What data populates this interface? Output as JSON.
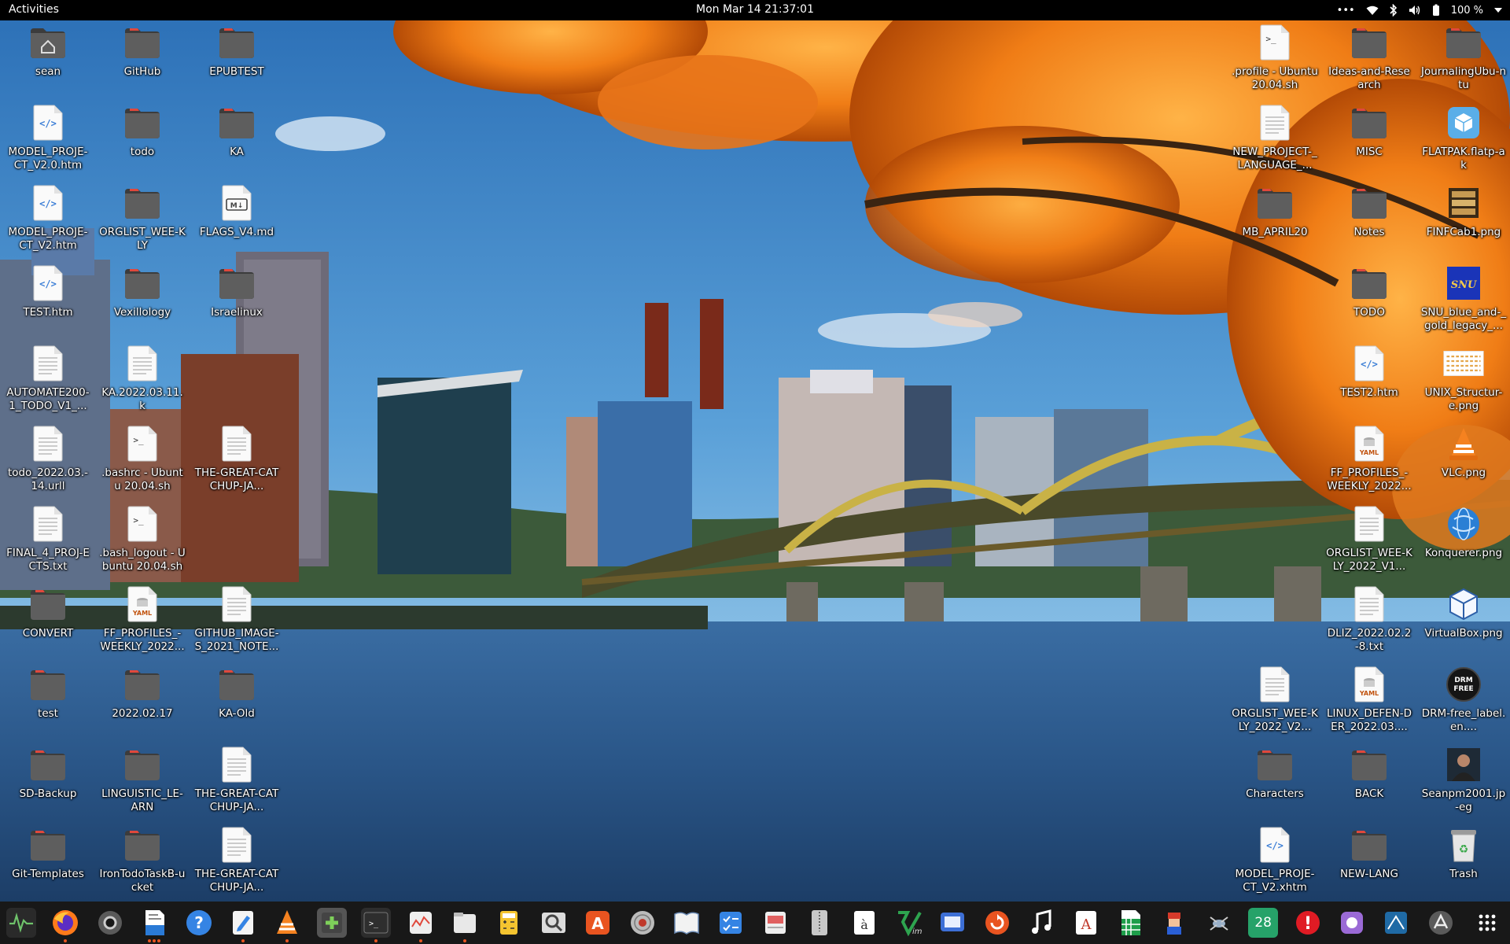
{
  "topbar": {
    "activities": "Activities",
    "clock": "Mon Mar 14  21:37:01",
    "battery": "100 %"
  },
  "desktop": {
    "icons": [
      {
        "label": "sean",
        "type": "home"
      },
      {
        "label": "GitHub",
        "type": "folder"
      },
      {
        "label": "EPUBTEST",
        "type": "folder"
      },
      {
        "label": "MODEL_PROJE-CT_V2.0.htm",
        "type": "html"
      },
      {
        "label": "todo",
        "type": "folder"
      },
      {
        "label": "KA",
        "type": "folder"
      },
      {
        "label": "MODEL_PROJE-CT_V2.htm",
        "type": "html"
      },
      {
        "label": "ORGLIST_WEE-KLY",
        "type": "folder"
      },
      {
        "label": "FLAGS_V4.md",
        "type": "md"
      },
      {
        "label": "TEST.htm",
        "type": "html"
      },
      {
        "label": "Vexillology",
        "type": "folder"
      },
      {
        "label": "Israelinux",
        "type": "folder"
      },
      {
        "label": "AUTOMATE200-1_TODO_V1_...",
        "type": "text"
      },
      {
        "label": "KA.2022.03.11.k",
        "type": "text"
      },
      {
        "label": "todo_2022.03.-14.urll",
        "type": "text"
      },
      {
        "label": ".bashrc - Ubuntu 20.04.sh",
        "type": "script"
      },
      {
        "label": "THE-GREAT-CATCHUP-JA...",
        "type": "text"
      },
      {
        "label": "FINAL_4_PROJ-ECTS.txt",
        "type": "text"
      },
      {
        "label": ".bash_logout - Ubuntu 20.04.sh",
        "type": "script"
      },
      {
        "label": "CONVERT",
        "type": "folder"
      },
      {
        "label": "FF_PROFILES_-WEEKLY_2022...",
        "type": "yaml"
      },
      {
        "label": "GITHUB_IMAGE-S_2021_NOTE...",
        "type": "text"
      },
      {
        "label": "test",
        "type": "folder"
      },
      {
        "label": "2022.02.17",
        "type": "folder"
      },
      {
        "label": "KA-Old",
        "type": "folder"
      },
      {
        "label": "SD-Backup",
        "type": "folder"
      },
      {
        "label": "LINGUISTIC_LE-ARN",
        "type": "folder"
      },
      {
        "label": "THE-GREAT-CATCHUP-JA...",
        "type": "text"
      },
      {
        "label": "Git-Templates",
        "type": "folder"
      },
      {
        "label": "IronTodoTaskB-ucket",
        "type": "folder"
      },
      {
        "label": "THE-GREAT-CATCHUP-JA...",
        "type": "text"
      },
      {
        "label": ".profile - Ubuntu 20.04.sh",
        "type": "script"
      },
      {
        "label": "Ideas-and-Research",
        "type": "folder"
      },
      {
        "label": "JournalingUbu-ntu",
        "type": "folder"
      },
      {
        "label": "NEW_PROJECT-_LANGUAGE_...",
        "type": "text"
      },
      {
        "label": "MISC",
        "type": "folder"
      },
      {
        "label": "FLATPAK.flatp-ak",
        "type": "flatpak"
      },
      {
        "label": "MB_APRIL20",
        "type": "folder"
      },
      {
        "label": "Notes",
        "type": "folder"
      },
      {
        "label": "FINFCab1.png",
        "type": "image-cabinet"
      },
      {
        "label": "TODO",
        "type": "folder"
      },
      {
        "label": "SNU_blue_and-_gold_legacy_...",
        "type": "image-snu"
      },
      {
        "label": "TEST2.htm",
        "type": "html"
      },
      {
        "label": "UNIX_Structur-e.png",
        "type": "image-unix"
      },
      {
        "label": "FF_PROFILES_-WEEKLY_2022...",
        "type": "yaml"
      },
      {
        "label": "VLC.png",
        "type": "image-vlc"
      },
      {
        "label": "ORGLIST_WEE-KLY_2022_V1...",
        "type": "text"
      },
      {
        "label": "Konquerer.png",
        "type": "image-globe"
      },
      {
        "label": "DLIZ_2022.02.2-8.txt",
        "type": "text"
      },
      {
        "label": "VirtualBox.png",
        "type": "image-vbox"
      },
      {
        "label": "ORGLIST_WEE-KLY_2022_V2...",
        "type": "text"
      },
      {
        "label": "LINUX_DEFEN-DER_2022.03....",
        "type": "yaml"
      },
      {
        "label": "DRM-free_label.en....",
        "type": "image-drm"
      },
      {
        "label": "Characters",
        "type": "folder"
      },
      {
        "label": "BACK",
        "type": "folder"
      },
      {
        "label": "Seanpm2001.jp-eg",
        "type": "image-photo"
      },
      {
        "label": "MODEL_PROJE-CT_V2.xhtm",
        "type": "html"
      },
      {
        "label": "NEW-LANG",
        "type": "folder"
      },
      {
        "label": "Trash",
        "type": "trash"
      }
    ],
    "glyph_text": {
      "html": "</>",
      "md": "M↓",
      "yaml": "YAML",
      "snu": "SNU",
      "drm": "DRM FREE",
      "script": ">_"
    }
  },
  "dock": {
    "apps": [
      {
        "name": "system-monitor"
      },
      {
        "name": "firefox"
      },
      {
        "name": "settings"
      },
      {
        "name": "libreoffice-writer"
      },
      {
        "name": "help"
      },
      {
        "name": "text-editor"
      },
      {
        "name": "vlc"
      },
      {
        "name": "gnome-tweaks"
      },
      {
        "name": "terminal"
      },
      {
        "name": "logs"
      },
      {
        "name": "files"
      },
      {
        "name": "calculator"
      },
      {
        "name": "image-viewer"
      },
      {
        "name": "app-center"
      },
      {
        "name": "disk-utility"
      },
      {
        "name": "document-reader"
      },
      {
        "name": "todo"
      },
      {
        "name": "bug-report"
      },
      {
        "name": "archive-manager"
      },
      {
        "name": "character-map"
      },
      {
        "name": "vim"
      },
      {
        "name": "screen"
      },
      {
        "name": "software-updater"
      },
      {
        "name": "music"
      },
      {
        "name": "font-viewer"
      },
      {
        "name": "libreoffice-calc"
      },
      {
        "name": "game"
      },
      {
        "name": "insect"
      },
      {
        "name": "calendar"
      },
      {
        "name": "error-report"
      },
      {
        "name": "screenshot"
      },
      {
        "name": "geo"
      },
      {
        "name": "app-store"
      },
      {
        "name": "show-applications"
      }
    ],
    "calendar_day": "28",
    "font_letter": "A"
  }
}
